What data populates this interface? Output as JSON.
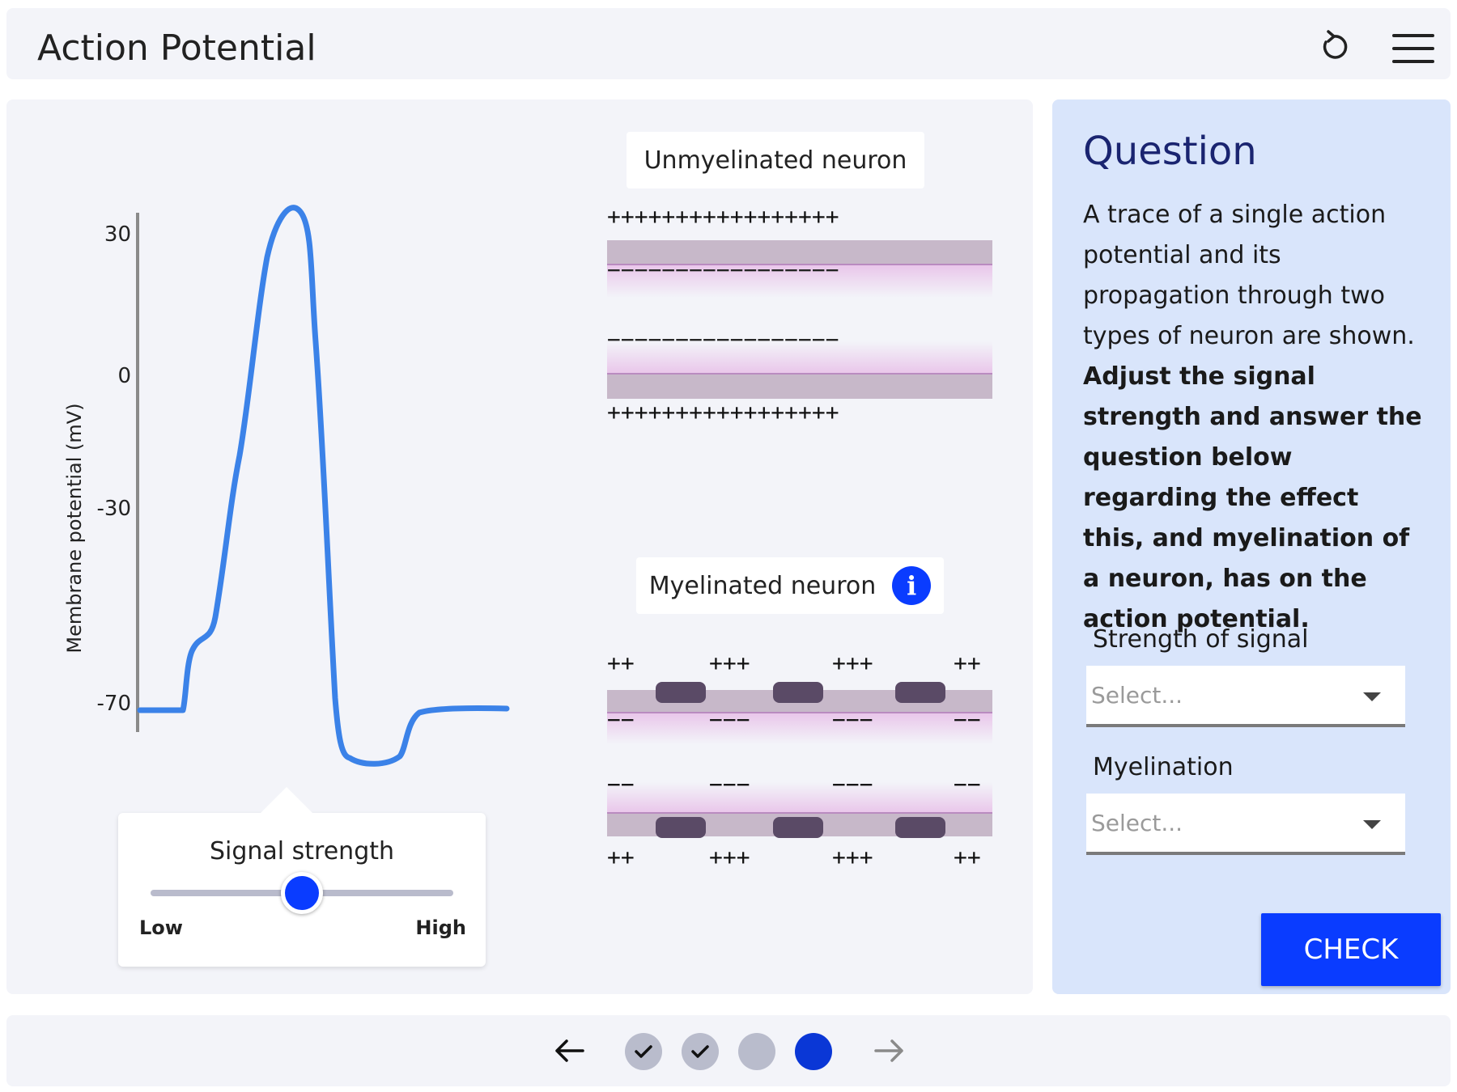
{
  "header": {
    "title": "Action Potential"
  },
  "graph": {
    "ylabel": "Membrane potential (mV)",
    "yticks": [
      "30",
      "0",
      "-30",
      "-70"
    ],
    "trace_color": "#3b82e8"
  },
  "chart_data": {
    "type": "line",
    "ylabel": "Membrane potential (mV)",
    "yticks": [
      30,
      0,
      -30,
      -70
    ],
    "series": [
      {
        "values": [
          -70,
          -70,
          -70,
          -58,
          -55,
          -45,
          -20,
          10,
          25,
          30,
          30,
          20,
          -10,
          -60,
          -78,
          -80,
          -80,
          -78,
          -72,
          -71,
          -71,
          -71
        ]
      }
    ]
  },
  "signal": {
    "title": "Signal strength",
    "low_label": "Low",
    "high_label": "High",
    "value_fraction": 0.5
  },
  "unmyelinated": {
    "label": "Unmyelinated neuron",
    "outer_charges": "+++++++++++++++++",
    "inner_charges": "−−−−−−−−−−−−−−−−−"
  },
  "myelinated": {
    "label": "Myelinated neuron",
    "info_icon": "i",
    "outer_charges": [
      "++",
      "+++",
      "+++",
      "++"
    ],
    "inner_charges": [
      "−−",
      "−−−",
      "−−−",
      "−−"
    ]
  },
  "question": {
    "title": "Question",
    "text_plain": "A trace of a single action potential and its propagation through two types of neuron are shown.",
    "text_bold": "Adjust the signal strength and answer the question below regarding the effect this, and myelination of a neuron, has on the action potential.",
    "field1_label": "Strength of signal",
    "field1_placeholder": "Select...",
    "field2_label": "Myelination",
    "field2_placeholder": "Select...",
    "check_label": "CHECK"
  },
  "footer": {
    "steps": [
      {
        "state": "completed"
      },
      {
        "state": "completed"
      },
      {
        "state": "pending"
      },
      {
        "state": "current"
      }
    ]
  },
  "colors": {
    "accent": "#0a3cff",
    "panel_bg": "#f3f4f9",
    "question_bg": "#d9e5fb",
    "membrane": "#c7b8c9",
    "myelin": "#5a4a66"
  }
}
